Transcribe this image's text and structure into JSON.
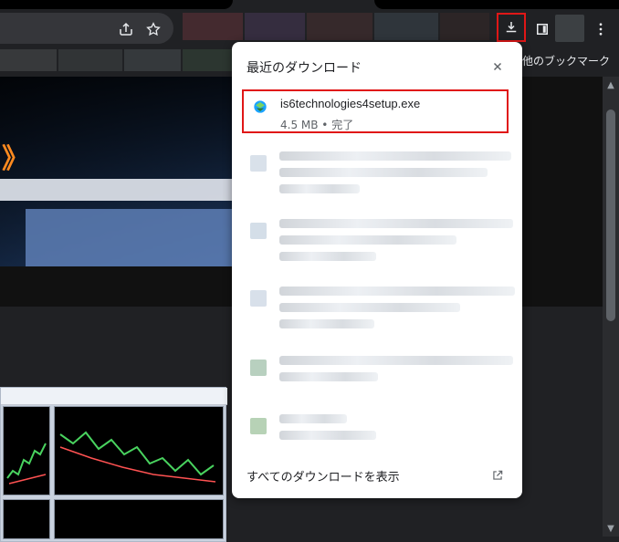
{
  "browser": {
    "toolbar": {
      "icons": {
        "share": "share-icon",
        "star": "star-icon",
        "download": "download-icon",
        "sidepanel": "side-panel-icon",
        "menu": "kebab-menu-icon"
      }
    },
    "bookmarks_bar": {
      "other_bookmarks_label": "その他のブックマーク"
    }
  },
  "download_panel": {
    "title": "最近のダウンロード",
    "close_icon": "close-icon",
    "first_item": {
      "filename": "is6technologies4setup.exe",
      "meta": "4.5 MB • 完了",
      "icon": "installer-icon"
    },
    "show_all_label": "すべてのダウンロードを表示",
    "open_external_icon": "open-in-new-icon"
  },
  "content": {
    "hero_mark": "》"
  },
  "colors": {
    "highlight": "#e01717",
    "chrome_dark": "#202124",
    "panel_bg": "#ffffff",
    "text_secondary": "#5f6368"
  }
}
